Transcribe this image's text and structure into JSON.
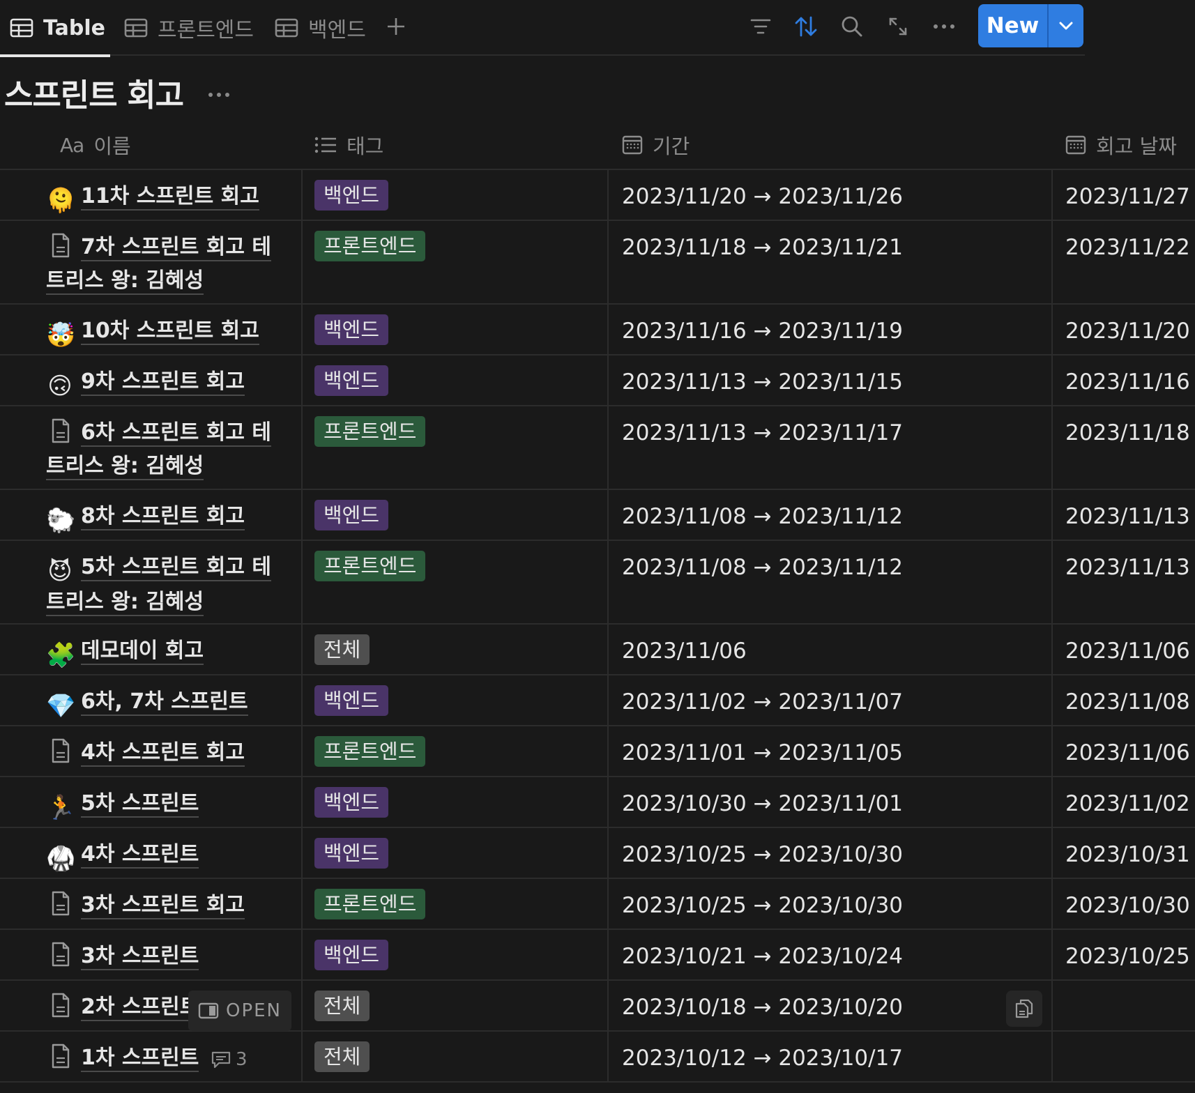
{
  "colors": {
    "background": "#191919",
    "accent_blue": "#2f7de1",
    "tag_backend": "#4a3468",
    "tag_frontend": "#2b5a3b",
    "tag_all": "#4f4f4f"
  },
  "toolbar": {
    "tabs": [
      {
        "label": "Table",
        "icon": "table-icon",
        "active": true
      },
      {
        "label": "프론트엔드",
        "icon": "table-icon",
        "active": false
      },
      {
        "label": "백엔드",
        "icon": "table-icon",
        "active": false
      }
    ],
    "add_view_icon": "plus-icon",
    "tools": [
      "filter-icon",
      "sort-icon",
      "search-icon",
      "expand-icon",
      "more-icon"
    ],
    "new_label": "New",
    "new_dropdown_icon": "chevron-down-icon"
  },
  "page": {
    "title": "스프린트 회고",
    "more_icon": "more-icon"
  },
  "table": {
    "columns": [
      {
        "label": "이름",
        "prefix": "Aa",
        "icon": "text-property-icon"
      },
      {
        "label": "태그",
        "icon": "list-icon"
      },
      {
        "label": "기간",
        "icon": "calendar-icon"
      },
      {
        "label": "회고 날짜",
        "icon": "calendar-icon"
      }
    ],
    "rows": [
      {
        "icon": "🫠",
        "icon_name": "melting-face-icon",
        "name": "11차 스프린트 회고",
        "tag": "백엔드",
        "tag_type": "backend",
        "period": "2023/11/20 → 2023/11/26",
        "retro_date": "2023/11/27"
      },
      {
        "icon": "",
        "icon_name": "page-icon",
        "name": "7차 스프린트 회고 테트리스 왕: 김혜성",
        "tag": "프론트엔드",
        "tag_type": "frontend",
        "period": "2023/11/18 → 2023/11/21",
        "retro_date": "2023/11/22"
      },
      {
        "icon": "🤯",
        "icon_name": "exploding-head-icon",
        "name": "10차 스프린트 회고",
        "tag": "백엔드",
        "tag_type": "backend",
        "period": "2023/11/16 → 2023/11/19",
        "retro_date": "2023/11/20"
      },
      {
        "icon": "🙃",
        "icon_name": "upside-down-face-icon",
        "name": "9차 스프린트 회고",
        "tag": "백엔드",
        "tag_type": "backend",
        "period": "2023/11/13 → 2023/11/15",
        "retro_date": "2023/11/16"
      },
      {
        "icon": "",
        "icon_name": "page-icon",
        "name": "6차 스프린트 회고 테트리스 왕: 김혜성",
        "tag": "프론트엔드",
        "tag_type": "frontend",
        "period": "2023/11/13 → 2023/11/17",
        "retro_date": "2023/11/18"
      },
      {
        "icon": "🐑",
        "icon_name": "sheep-icon",
        "name": "8차 스프린트 회고",
        "tag": "백엔드",
        "tag_type": "backend",
        "period": "2023/11/08 → 2023/11/12",
        "retro_date": "2023/11/13"
      },
      {
        "icon": "😈",
        "icon_name": "smiling-devil-icon",
        "name": "5차 스프린트 회고 테트리스 왕: 김혜성",
        "tag": "프론트엔드",
        "tag_type": "frontend",
        "period": "2023/11/08 → 2023/11/12",
        "retro_date": "2023/11/13"
      },
      {
        "icon": "🧩",
        "icon_name": "puzzle-piece-icon",
        "name": "데모데이 회고",
        "tag": "전체",
        "tag_type": "all",
        "period": "2023/11/06",
        "retro_date": "2023/11/06"
      },
      {
        "icon": "💎",
        "icon_name": "gem-icon",
        "name": "6차, 7차 스프린트",
        "tag": "백엔드",
        "tag_type": "backend",
        "period": "2023/11/02 → 2023/11/07",
        "retro_date": "2023/11/08"
      },
      {
        "icon": "",
        "icon_name": "page-icon",
        "name": "4차 스프린트 회고",
        "tag": "프론트엔드",
        "tag_type": "frontend",
        "period": "2023/11/01 → 2023/11/05",
        "retro_date": "2023/11/06"
      },
      {
        "icon": "🏃",
        "icon_name": "running-person-icon",
        "name": "5차 스프린트",
        "tag": "백엔드",
        "tag_type": "backend",
        "period": "2023/10/30 → 2023/11/01",
        "retro_date": "2023/11/02"
      },
      {
        "icon": "🥋",
        "icon_name": "martial-arts-uniform-icon",
        "name": "4차 스프린트",
        "tag": "백엔드",
        "tag_type": "backend",
        "period": "2023/10/25 → 2023/10/30",
        "retro_date": "2023/10/31"
      },
      {
        "icon": "",
        "icon_name": "page-icon",
        "name": "3차 스프린트 회고",
        "tag": "프론트엔드",
        "tag_type": "frontend",
        "period": "2023/10/25 → 2023/10/30",
        "retro_date": "2023/10/30"
      },
      {
        "icon": "",
        "icon_name": "page-icon",
        "name": "3차 스프린트",
        "tag": "백엔드",
        "tag_type": "backend",
        "period": "2023/10/21 → 2023/10/24",
        "retro_date": "2023/10/25"
      },
      {
        "icon": "",
        "icon_name": "page-icon",
        "name": "2차 스프린트",
        "tag": "전체",
        "tag_type": "all",
        "period": "2023/10/18 → 2023/10/20",
        "retro_date": "",
        "hover_open_label": "OPEN",
        "show_copy_button": true
      },
      {
        "icon": "",
        "icon_name": "page-icon",
        "name": "1차 스프린트",
        "tag": "전체",
        "tag_type": "all",
        "period": "2023/10/12 → 2023/10/17",
        "retro_date": "",
        "comment_count": "3"
      }
    ]
  }
}
